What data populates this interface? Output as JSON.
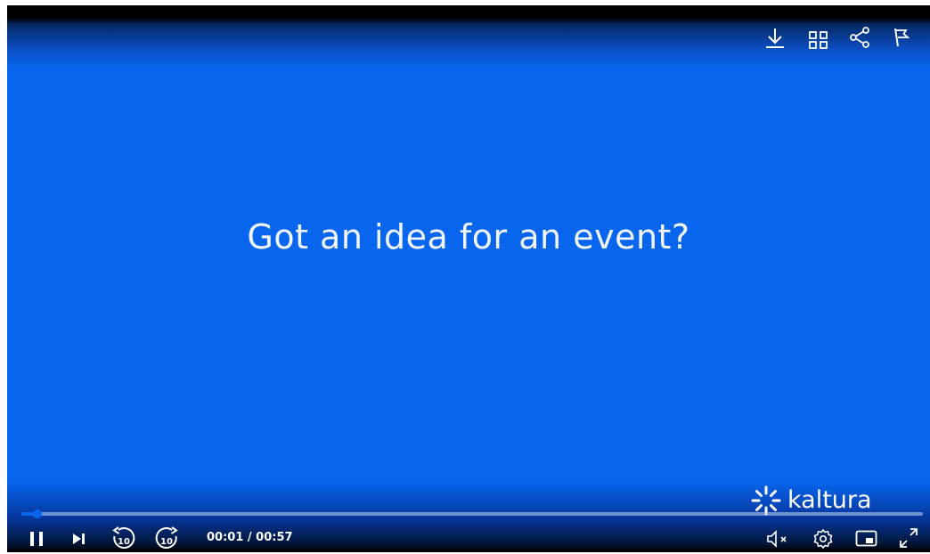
{
  "slide": {
    "text": "Got an idea for an event?"
  },
  "branding": {
    "logo_text": "kaltura"
  },
  "top_controls": {
    "icons": [
      "download-icon",
      "playlist-grid-icon",
      "share-icon",
      "report-flag-icon"
    ]
  },
  "playback": {
    "state": "playing",
    "current_time": "00:01",
    "duration": "00:57",
    "time_display": "00:01 / 00:57",
    "progress_fraction": 0.0175,
    "seek_back_label": "10",
    "seek_forward_label": "10",
    "muted": true
  },
  "bottom_controls": {
    "left": [
      "pause-icon",
      "next-icon",
      "rewind-10-icon",
      "forward-10-icon"
    ],
    "right": [
      "volume-muted-icon",
      "settings-gear-icon",
      "picture-in-picture-icon",
      "fullscreen-icon"
    ]
  },
  "colors": {
    "video_background": "#0866ee",
    "text": "#ffffff",
    "progress_fill": "#0866ee",
    "progress_track": "#c8d7f0"
  }
}
